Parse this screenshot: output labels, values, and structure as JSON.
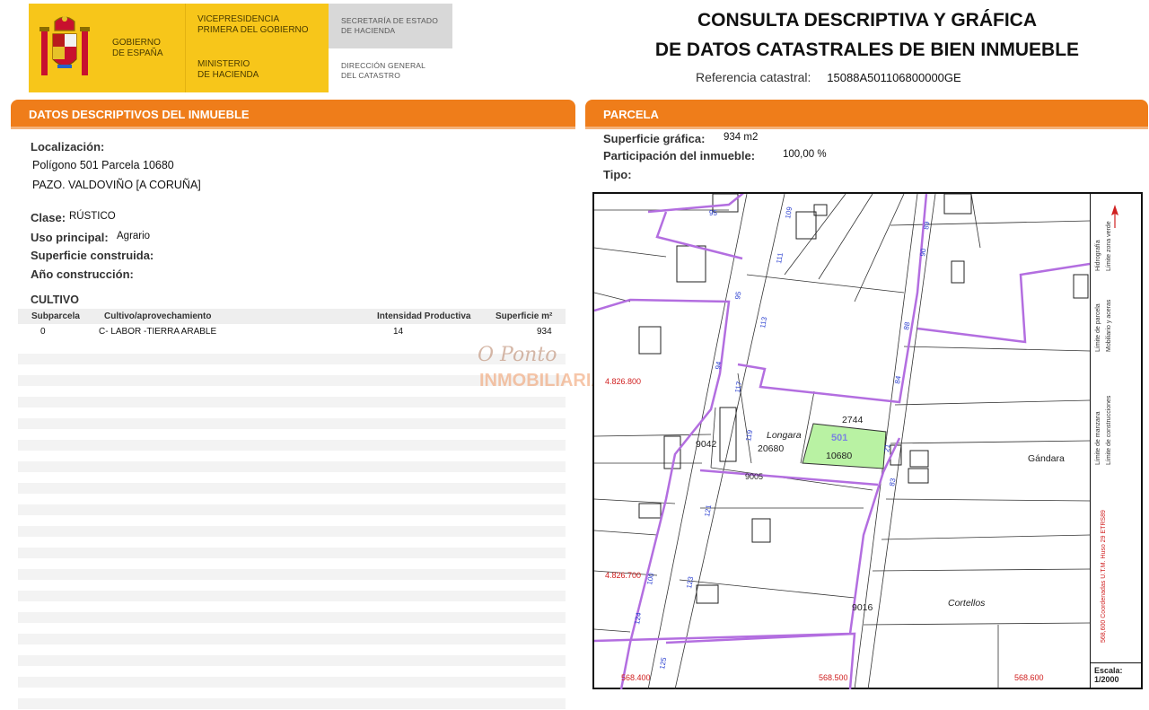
{
  "header": {
    "gov_name": [
      "GOBIERNO",
      "DE ESPAÑA"
    ],
    "vicepresidencia": [
      "VICEPRESIDENCIA",
      "PRIMERA DEL GOBIERNO"
    ],
    "ministerio": [
      "MINISTERIO",
      "DE HACIENDA"
    ],
    "secretaria": [
      "SECRETARÍA DE ESTADO",
      "DE HACIENDA"
    ],
    "direccion": [
      "DIRECCIÓN GENERAL",
      "DEL CATASTRO"
    ],
    "title_line1": "CONSULTA DESCRIPTIVA Y GRÁFICA",
    "title_line2": "DE DATOS CATASTRALES DE BIEN INMUEBLE",
    "ref_label": "Referencia catastral:",
    "ref_value": "15088A501106800000GE"
  },
  "left": {
    "bar_title": "DATOS DESCRIPTIVOS DEL INMUEBLE",
    "localizacion_label": "Localización:",
    "loc_line1": "Polígono 501 Parcela 10680",
    "loc_line2": "PAZO. VALDOVIÑO [A CORUÑA]",
    "clase_label": "Clase:",
    "clase_value": "RÚSTICO",
    "uso_label": "Uso principal:",
    "uso_value": "Agrario",
    "sup_label": "Superficie construida:",
    "anio_label": "Año construcción:",
    "cultivo_title": "CULTIVO",
    "table_headers": [
      "Subparcela",
      "Cultivo/aprovechamiento",
      "Intensidad Productiva",
      "Superficie m²"
    ],
    "rows": [
      [
        "0",
        "C- LABOR -TIERRA ARABLE",
        "14",
        "934"
      ]
    ]
  },
  "watermark": {
    "line1": "O Ponto",
    "line2": "INMOBILIARIA"
  },
  "right": {
    "bar_title": "PARCELA",
    "sup_grafica_label": "Superficie gráfica:",
    "sup_grafica_value": "934 m2",
    "participacion_label": "Participación del inmueble:",
    "participacion_value": "100,00 %",
    "tipo_label": "Tipo:"
  },
  "map": {
    "poligono": "501",
    "parcela": "10680",
    "labels": {
      "longara": "Longara",
      "gandara": "Gándara",
      "cortellos": "Cortellos",
      "n2744": "2744",
      "n9042": "9042",
      "n20680": "20680",
      "n9016": "9016",
      "n9005": "9005",
      "y1": "4.826.800",
      "y2": "4.826.700",
      "x1": "568.400",
      "x2": "568.500",
      "x3": "568.600"
    },
    "legend": [
      "Límite zona verde",
      "Hidrografía",
      "Límite de parcela",
      "Mobiliario y aceras",
      "Límite de construcciones",
      "Límite de manzana",
      "568,600 Coordenadas U.T.M. Huso 29 ETRS89"
    ],
    "scale_label": "Escala:",
    "scale_value": "1/2000",
    "colors": {
      "manzana": "#b36ee0",
      "parcel_fill": "#b9f2a3",
      "road_numbers": "#2a3fd0",
      "coords": "#d02020"
    }
  }
}
